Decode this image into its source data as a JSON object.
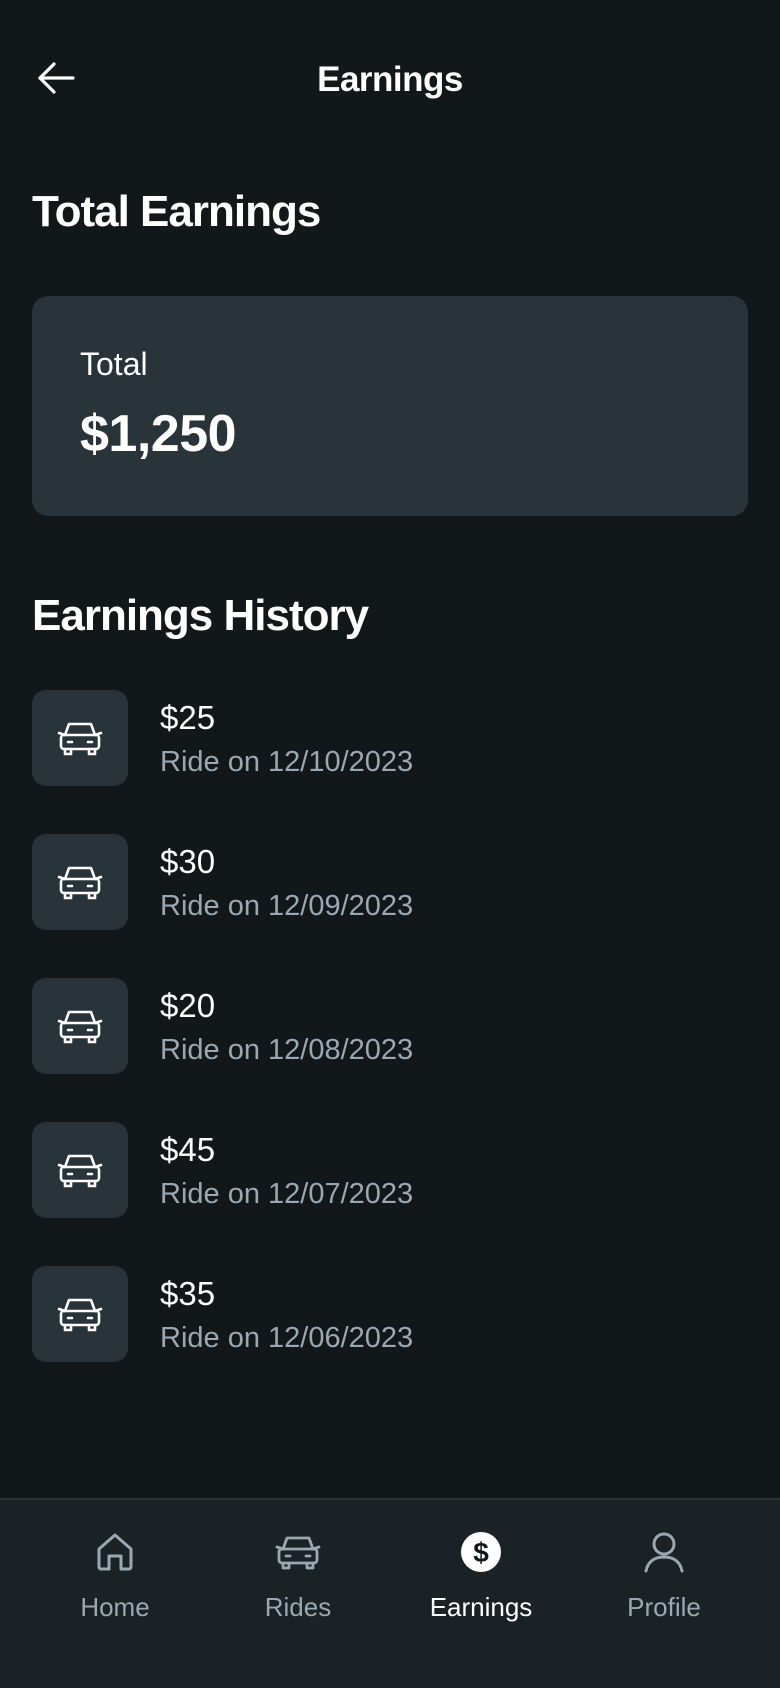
{
  "header": {
    "title": "Earnings",
    "back_icon": "arrow-left-icon"
  },
  "total_section": {
    "heading": "Total Earnings",
    "card_label": "Total",
    "card_value": "$1,250"
  },
  "history": {
    "heading": "Earnings History",
    "items": [
      {
        "amount": "$25",
        "description": "Ride on 12/10/2023",
        "icon": "car-icon"
      },
      {
        "amount": "$30",
        "description": "Ride on 12/09/2023",
        "icon": "car-icon"
      },
      {
        "amount": "$20",
        "description": "Ride on 12/08/2023",
        "icon": "car-icon"
      },
      {
        "amount": "$45",
        "description": "Ride on 12/07/2023",
        "icon": "car-icon"
      },
      {
        "amount": "$35",
        "description": "Ride on 12/06/2023",
        "icon": "car-icon"
      }
    ]
  },
  "bottom_nav": {
    "items": [
      {
        "label": "Home",
        "icon": "home-icon"
      },
      {
        "label": "Rides",
        "icon": "car-icon"
      },
      {
        "label": "Earnings",
        "icon": "dollar-circle-icon",
        "active": true
      },
      {
        "label": "Profile",
        "icon": "user-icon"
      }
    ]
  },
  "colors": {
    "background": "#12171a",
    "card": "#28333a",
    "nav_background": "#1b2226",
    "muted_text": "#9aa8b2",
    "text": "#ffffff"
  }
}
